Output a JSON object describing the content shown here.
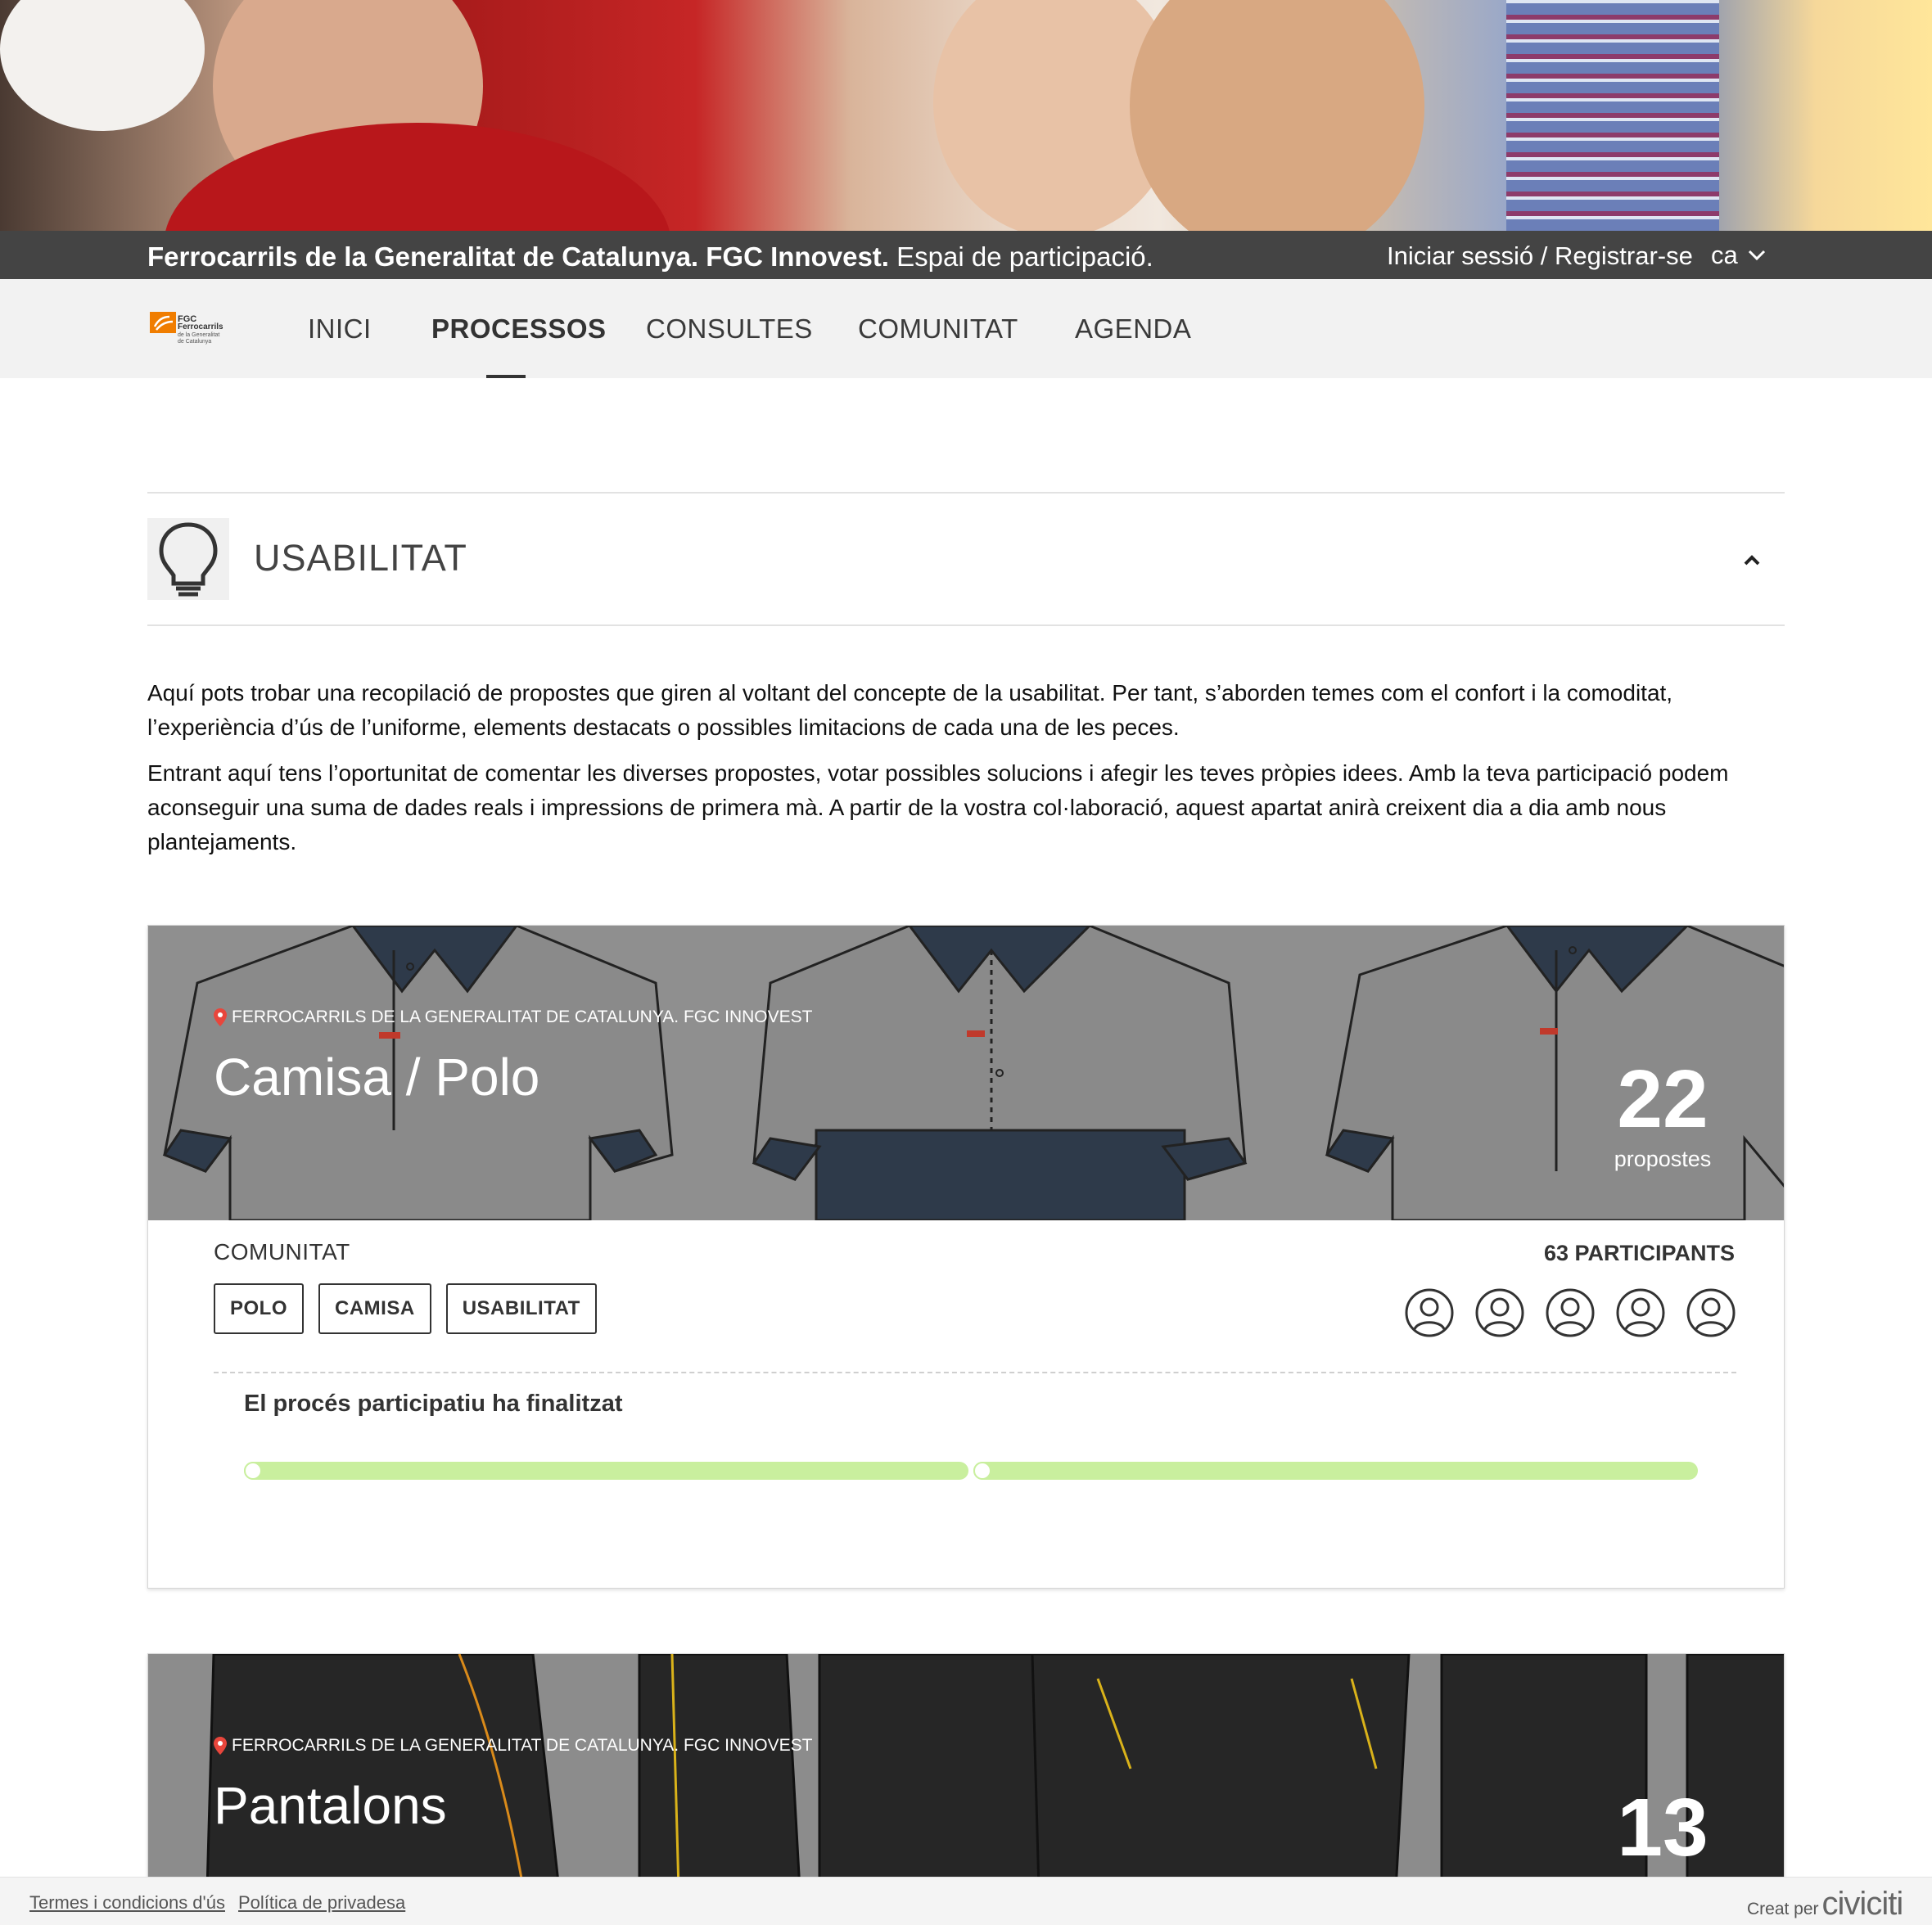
{
  "header": {
    "brand_bold": "Ferrocarrils de la Generalitat de Catalunya. FGC Innovest.",
    "brand_rest": " Espai de participació.",
    "login": "Iniciar sessió / Registrar-se",
    "language": "ca"
  },
  "logo": {
    "line1": "FGC",
    "line2": "Ferrocarrils",
    "line3": "de la Generalitat",
    "line4": "de Catalunya"
  },
  "nav": {
    "items": [
      "INICI",
      "PROCESSOS",
      "CONSULTES",
      "COMUNITAT",
      "AGENDA"
    ],
    "active": "PROCESSOS"
  },
  "section": {
    "title": "USABILITAT",
    "icon": "lightbulb-icon",
    "paragraphs": [
      "Aquí pots trobar una recopilació de propostes que giren al voltant del concepte de la usabilitat. Per tant, s’aborden temes com el confort i la comoditat, l’experiència d’ús de l’uniforme, elements destacats o possibles limitacions de cada una de les peces.",
      "Entrant aquí tens l’oportunitat de comentar les diverses propostes, votar possibles solucions i afegir les teves pròpies idees. Amb la teva participació podem aconseguir una suma de dades reals i impressions de primera mà. A partir de la vostra col·laboració, aquest apartat anirà creixent dia a dia amb nous plantejaments."
    ]
  },
  "cards": [
    {
      "org": "FERROCARRILS DE LA GENERALITAT DE CATALUNYA. FGC INNOVEST",
      "title": "Camisa / Polo",
      "count": "22",
      "count_label": "propostes",
      "category": "COMUNITAT",
      "tags": [
        "POLO",
        "CAMISA",
        "USABILITAT"
      ],
      "participants": "63 PARTICIPANTS",
      "status": "El procés participatiu ha finalitzat",
      "progress": 1.0
    },
    {
      "org": "FERROCARRILS DE LA GENERALITAT DE CATALUNYA. FGC INNOVEST",
      "title": "Pantalons",
      "count": "13"
    }
  ],
  "footer": {
    "terms": "Termes i condicions d'ús",
    "privacy": "Política de privadesa",
    "credit_prefix": "Creat per",
    "credit_brand": "civiciti"
  },
  "colors": {
    "header_bar": "#444444",
    "nav_bg": "#f2f2f2",
    "progress": "#c9ef9e",
    "pin": "#e8463c",
    "logo_orange": "#f07d00"
  }
}
